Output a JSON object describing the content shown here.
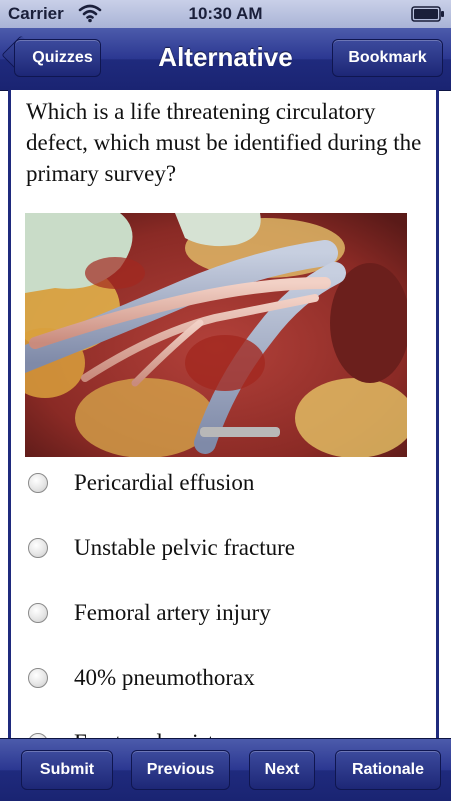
{
  "status_bar": {
    "carrier": "Carrier",
    "time": "10:30 AM",
    "wifi_icon": "wifi-icon",
    "battery_icon": "battery-icon"
  },
  "nav": {
    "title": "Alternative",
    "back_label": "Quizzes",
    "bookmark_label": "Bookmark"
  },
  "question": {
    "text": "Which is a life threatening circulatory defect, which must be identified during the primary survey?",
    "options": [
      {
        "label": "Pericardial effusion"
      },
      {
        "label": "Unstable pelvic fracture"
      },
      {
        "label": "Femoral artery injury"
      },
      {
        "label": "40% pneumothorax"
      },
      {
        "label": "Fractured wrist"
      }
    ]
  },
  "toolbar": {
    "submit_label": "Submit",
    "previous_label": "Previous",
    "next_label": "Next",
    "rationale_label": "Rationale"
  },
  "colors": {
    "bar_blue": "#1f2a7d",
    "bar_highlight": "#4c5bab",
    "status_bar": "#b3bcdc"
  }
}
